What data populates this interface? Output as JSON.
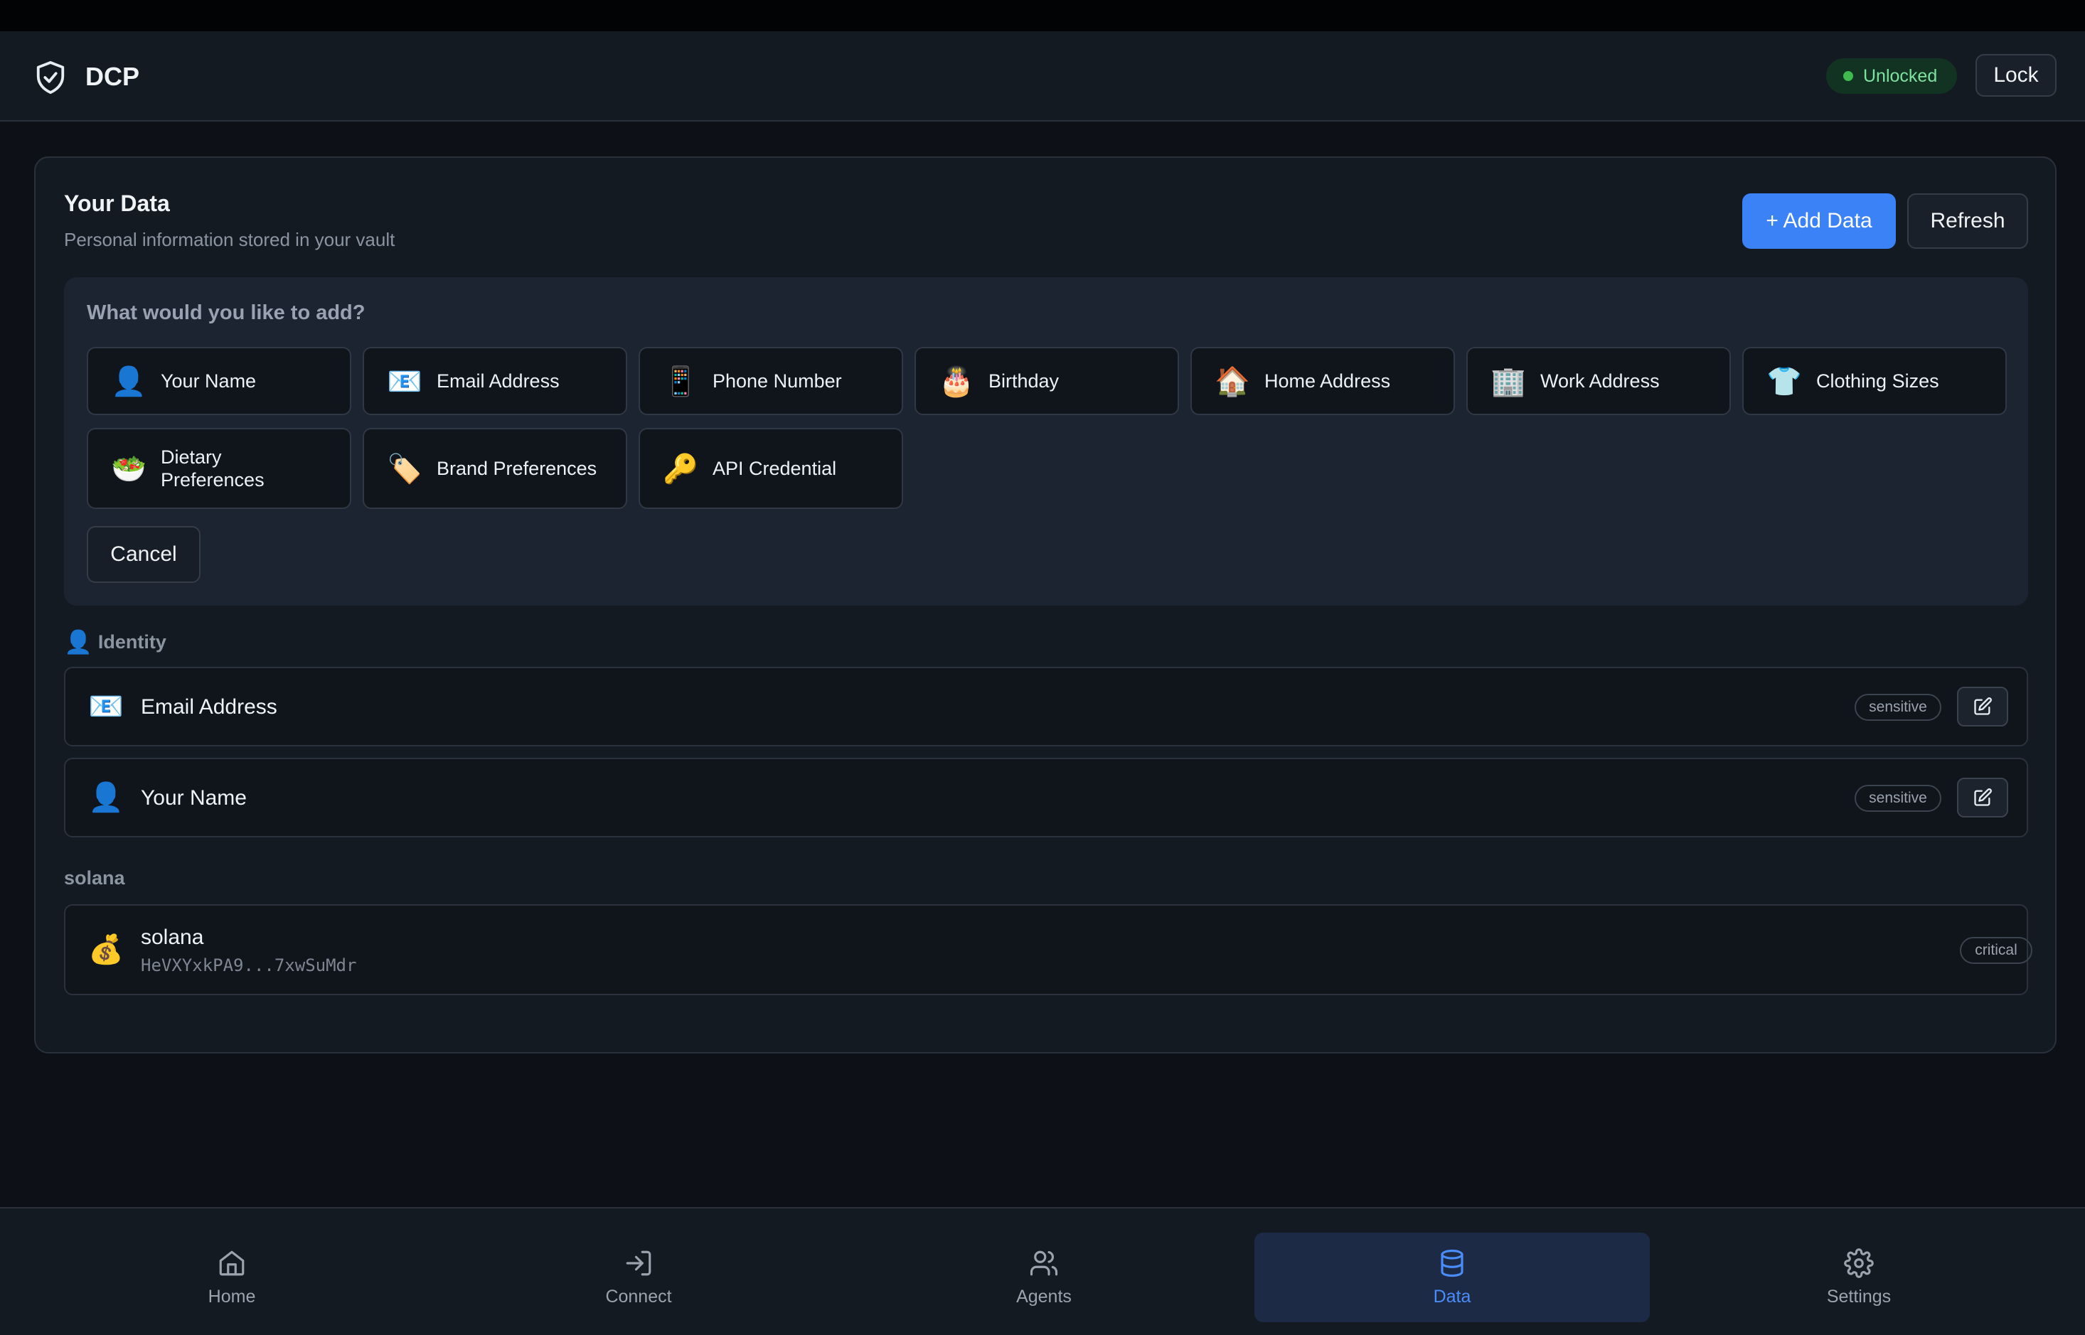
{
  "app": {
    "title": "DCP"
  },
  "header": {
    "status": "Unlocked",
    "lock_label": "Lock"
  },
  "card": {
    "title": "Your Data",
    "subtitle": "Personal information stored in your vault",
    "add_label": "+ Add Data",
    "refresh_label": "Refresh"
  },
  "add_panel": {
    "title": "What would you like to add?",
    "options": [
      {
        "icon": "👤",
        "label": "Your Name"
      },
      {
        "icon": "📧",
        "label": "Email Address"
      },
      {
        "icon": "📱",
        "label": "Phone Number"
      },
      {
        "icon": "🎂",
        "label": "Birthday"
      },
      {
        "icon": "🏠",
        "label": "Home Address"
      },
      {
        "icon": "🏢",
        "label": "Work Address"
      },
      {
        "icon": "👕",
        "label": "Clothing Sizes"
      },
      {
        "icon": "🥗",
        "label": "Dietary Preferences"
      },
      {
        "icon": "🏷️",
        "label": "Brand Preferences"
      },
      {
        "icon": "🔑",
        "label": "API Credential"
      }
    ],
    "cancel_label": "Cancel"
  },
  "sections": [
    {
      "icon": "👤",
      "title": "Identity",
      "items": [
        {
          "icon": "📧",
          "label": "Email Address",
          "tag": "sensitive"
        },
        {
          "icon": "👤",
          "label": "Your Name",
          "tag": "sensitive"
        }
      ]
    },
    {
      "title": "solana",
      "items": [
        {
          "icon": "💰",
          "label": "solana",
          "sublabel": "HeVXYxkPA9...7xwSuMdr",
          "tag": "critical"
        }
      ]
    }
  ],
  "nav": [
    {
      "label": "Home"
    },
    {
      "label": "Connect"
    },
    {
      "label": "Agents"
    },
    {
      "label": "Data"
    },
    {
      "label": "Settings"
    }
  ],
  "colors": {
    "accent": "#3b82f6",
    "success": "#3fb950",
    "background": "#0d1117"
  }
}
